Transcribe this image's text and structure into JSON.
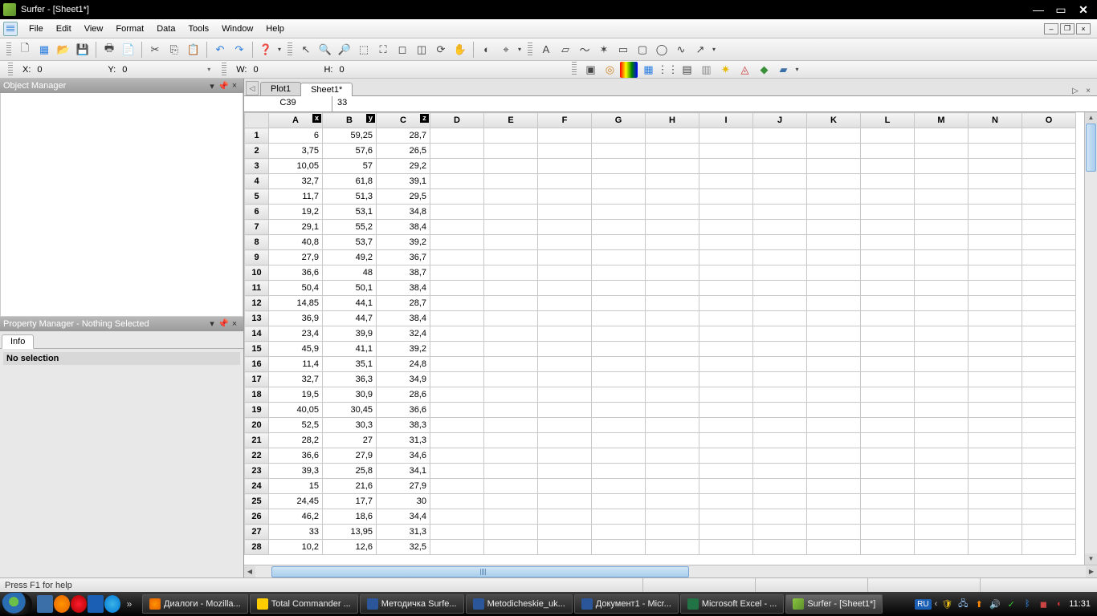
{
  "title": "Surfer - [Sheet1*]",
  "menu": [
    "File",
    "Edit",
    "View",
    "Format",
    "Data",
    "Tools",
    "Window",
    "Help"
  ],
  "coords": {
    "x_label": "X:",
    "x": "0",
    "y_label": "Y:",
    "y": "0",
    "w_label": "W:",
    "w": "0",
    "h_label": "H:",
    "h": "0"
  },
  "objmgr": {
    "title": "Object Manager"
  },
  "propmgr": {
    "title": "Property Manager - Nothing Selected",
    "tab": "Info",
    "body": "No selection"
  },
  "sheet": {
    "tabs": [
      "Plot1",
      "Sheet1*"
    ],
    "active_tab": 1,
    "cell_ref": "C39",
    "cell_val": "33",
    "columns": [
      "A",
      "B",
      "C",
      "D",
      "E",
      "F",
      "G",
      "H",
      "I",
      "J",
      "K",
      "L",
      "M",
      "N",
      "O"
    ],
    "axis_tags": {
      "A": "x",
      "B": "y",
      "C": "z"
    },
    "rows": [
      {
        "n": 1,
        "A": "6",
        "B": "59,25",
        "C": "28,7"
      },
      {
        "n": 2,
        "A": "3,75",
        "B": "57,6",
        "C": "26,5"
      },
      {
        "n": 3,
        "A": "10,05",
        "B": "57",
        "C": "29,2"
      },
      {
        "n": 4,
        "A": "32,7",
        "B": "61,8",
        "C": "39,1"
      },
      {
        "n": 5,
        "A": "11,7",
        "B": "51,3",
        "C": "29,5"
      },
      {
        "n": 6,
        "A": "19,2",
        "B": "53,1",
        "C": "34,8"
      },
      {
        "n": 7,
        "A": "29,1",
        "B": "55,2",
        "C": "38,4"
      },
      {
        "n": 8,
        "A": "40,8",
        "B": "53,7",
        "C": "39,2"
      },
      {
        "n": 9,
        "A": "27,9",
        "B": "49,2",
        "C": "36,7"
      },
      {
        "n": 10,
        "A": "36,6",
        "B": "48",
        "C": "38,7"
      },
      {
        "n": 11,
        "A": "50,4",
        "B": "50,1",
        "C": "38,4"
      },
      {
        "n": 12,
        "A": "14,85",
        "B": "44,1",
        "C": "28,7"
      },
      {
        "n": 13,
        "A": "36,9",
        "B": "44,7",
        "C": "38,4"
      },
      {
        "n": 14,
        "A": "23,4",
        "B": "39,9",
        "C": "32,4"
      },
      {
        "n": 15,
        "A": "45,9",
        "B": "41,1",
        "C": "39,2"
      },
      {
        "n": 16,
        "A": "11,4",
        "B": "35,1",
        "C": "24,8"
      },
      {
        "n": 17,
        "A": "32,7",
        "B": "36,3",
        "C": "34,9"
      },
      {
        "n": 18,
        "A": "19,5",
        "B": "30,9",
        "C": "28,6"
      },
      {
        "n": 19,
        "A": "40,05",
        "B": "30,45",
        "C": "36,6"
      },
      {
        "n": 20,
        "A": "52,5",
        "B": "30,3",
        "C": "38,3"
      },
      {
        "n": 21,
        "A": "28,2",
        "B": "27",
        "C": "31,3"
      },
      {
        "n": 22,
        "A": "36,6",
        "B": "27,9",
        "C": "34,6"
      },
      {
        "n": 23,
        "A": "39,3",
        "B": "25,8",
        "C": "34,1"
      },
      {
        "n": 24,
        "A": "15",
        "B": "21,6",
        "C": "27,9"
      },
      {
        "n": 25,
        "A": "24,45",
        "B": "17,7",
        "C": "30"
      },
      {
        "n": 26,
        "A": "46,2",
        "B": "18,6",
        "C": "34,4"
      },
      {
        "n": 27,
        "A": "33",
        "B": "13,95",
        "C": "31,3"
      },
      {
        "n": 28,
        "A": "10,2",
        "B": "12,6",
        "C": "32,5"
      }
    ]
  },
  "status": "Press F1 for help",
  "taskbar": {
    "items": [
      {
        "label": "Диалоги - Mozilla...",
        "icon": "ico-ff"
      },
      {
        "label": "Total Commander ...",
        "icon": "ico-tc"
      },
      {
        "label": "Методичка Surfe...",
        "icon": "ico-word"
      },
      {
        "label": "Metodicheskie_uk...",
        "icon": "ico-word"
      },
      {
        "label": "Документ1 - Micr...",
        "icon": "ico-word"
      },
      {
        "label": "Microsoft Excel - ...",
        "icon": "ico-excel"
      },
      {
        "label": "Surfer - [Sheet1*]",
        "icon": "ico-surfer",
        "active": true
      }
    ],
    "lang": "RU",
    "time": "11:31"
  }
}
